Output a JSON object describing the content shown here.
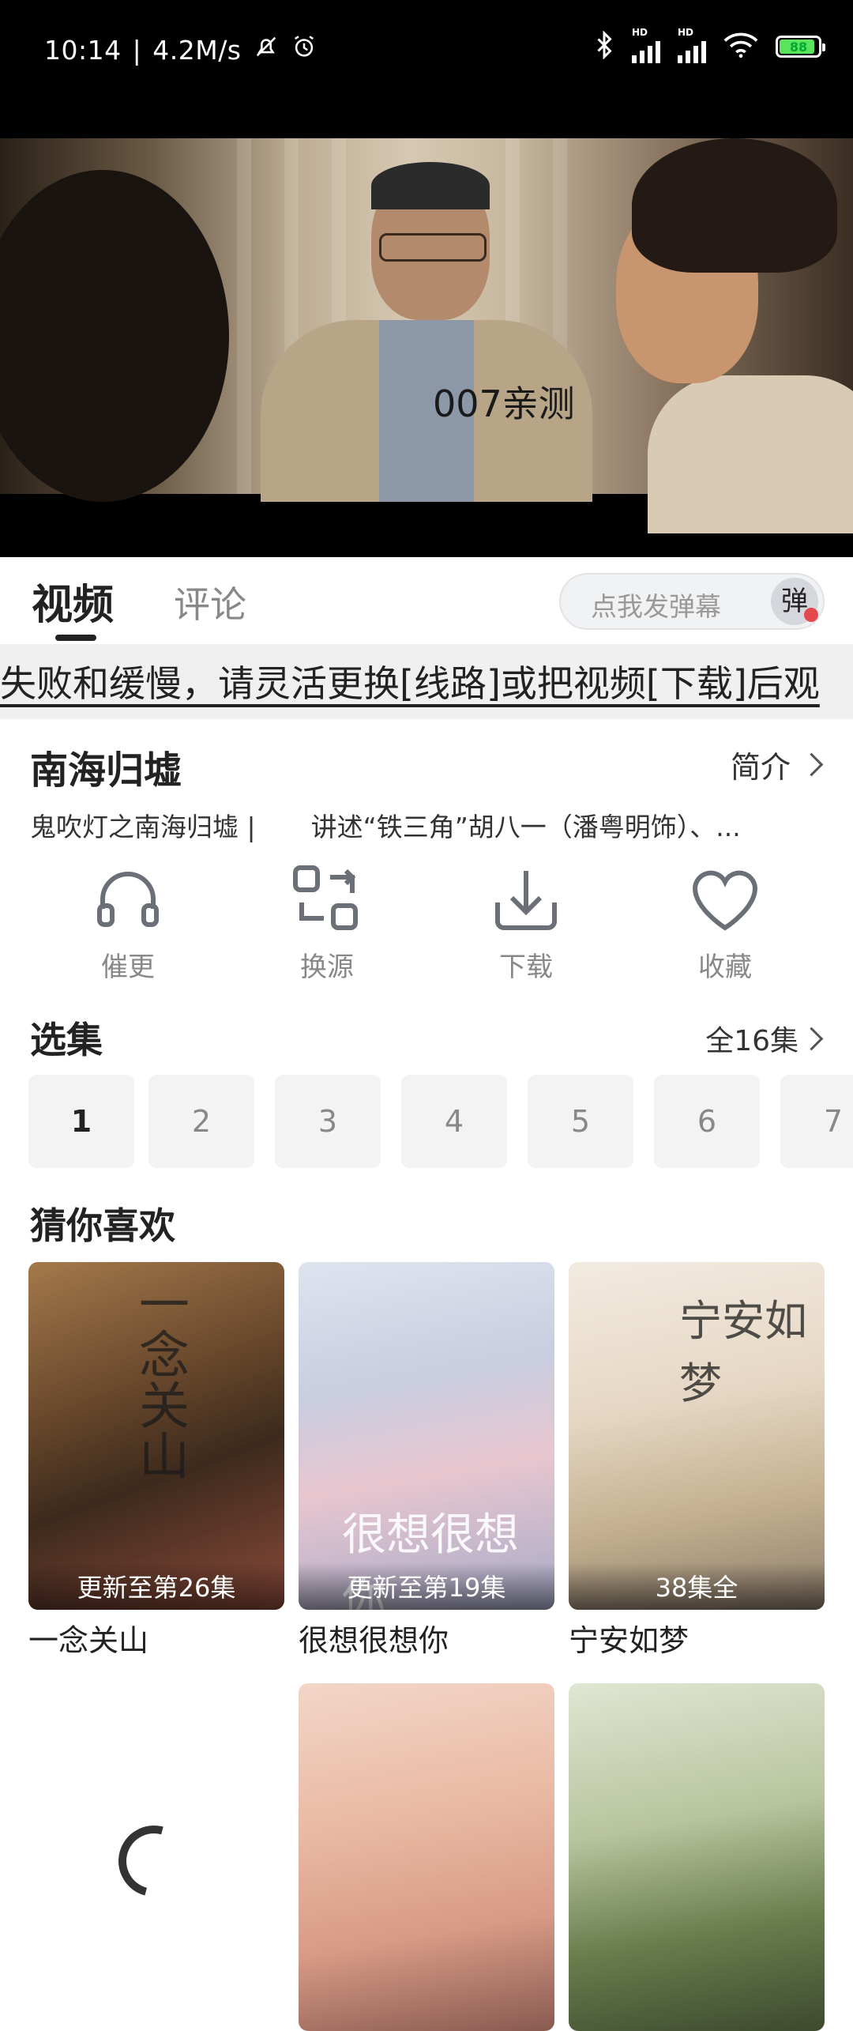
{
  "status_bar": {
    "time": "10:14",
    "speed": "4.2M/s",
    "battery": "88",
    "signal_label": "HD"
  },
  "player": {
    "watermark": "007亲测"
  },
  "tabs": {
    "video": "视频",
    "comments": "评论"
  },
  "danmu": {
    "placeholder": "点我发弹幕",
    "button": "弹"
  },
  "marquee": {
    "text": "失败和缓慢，请灵活更换[线路]或把视频[下载]后观"
  },
  "show": {
    "title": "南海归墟",
    "intro_label": "简介",
    "desc_left": "鬼吹灯之南海归墟 |",
    "desc_right": "讲述“铁三角”胡八一（潘粤明饰）、..."
  },
  "actions": [
    {
      "label": "催更",
      "icon": "headphones-icon"
    },
    {
      "label": "换源",
      "icon": "switch-source-icon"
    },
    {
      "label": "下载",
      "icon": "download-icon"
    },
    {
      "label": "收藏",
      "icon": "heart-icon"
    }
  ],
  "episodes": {
    "title": "选集",
    "all_label": "全16集",
    "items": [
      "1",
      "2",
      "3",
      "4",
      "5",
      "6",
      "7"
    ]
  },
  "recommend": {
    "title": "猜你喜欢",
    "items": [
      {
        "name": "一念关山",
        "badge": "更新至第26集"
      },
      {
        "name": "很想很想你",
        "badge": "更新至第19集"
      },
      {
        "name": "宁安如梦",
        "badge": "38集全"
      },
      {
        "name": "",
        "badge": ""
      },
      {
        "name": "",
        "badge": ""
      }
    ]
  },
  "colors": {
    "accent": "#222222",
    "marquee_bg": "#f0f0f0",
    "danmu_dot": "#e5484d"
  }
}
